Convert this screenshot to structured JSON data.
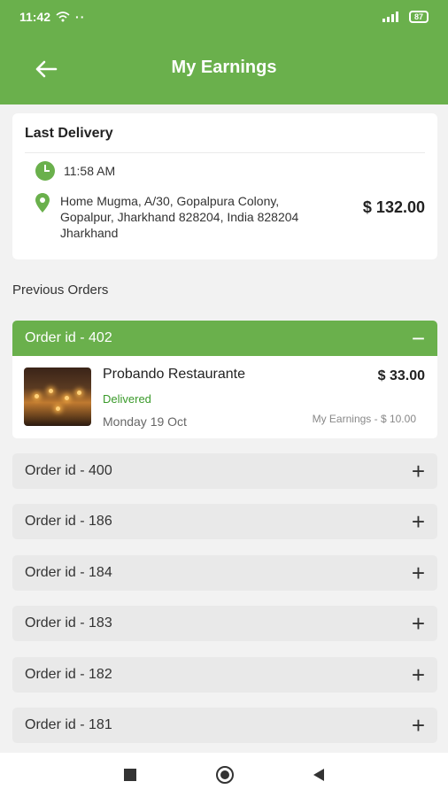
{
  "status_bar": {
    "time": "11:42",
    "battery": "87"
  },
  "header": {
    "title": "My Earnings"
  },
  "last_delivery": {
    "title": "Last Delivery",
    "time": "11:58 AM",
    "address": "Home Mugma, A/30, Gopalpura Colony, Gopalpur, Jharkhand 828204, India 828204 Jharkhand",
    "amount": "$ 132.00"
  },
  "previous_orders": {
    "title": "Previous Orders",
    "expanded": {
      "label": "Order id - 402",
      "toggle": "−",
      "restaurant": "Probando Restaurante",
      "status": "Delivered",
      "date": "Monday 19 Oct",
      "amount": "$ 33.00",
      "earnings": "My Earnings - $ 10.00"
    },
    "collapsed": [
      {
        "label": "Order id - 400",
        "toggle": "+"
      },
      {
        "label": "Order id - 186",
        "toggle": "+"
      },
      {
        "label": "Order id - 184",
        "toggle": "+"
      },
      {
        "label": "Order id - 183",
        "toggle": "+"
      },
      {
        "label": "Order id - 182",
        "toggle": "+"
      },
      {
        "label": "Order id - 181",
        "toggle": "+"
      }
    ]
  },
  "colors": {
    "accent": "#6ab04c",
    "delivered": "#3a9a2a"
  }
}
